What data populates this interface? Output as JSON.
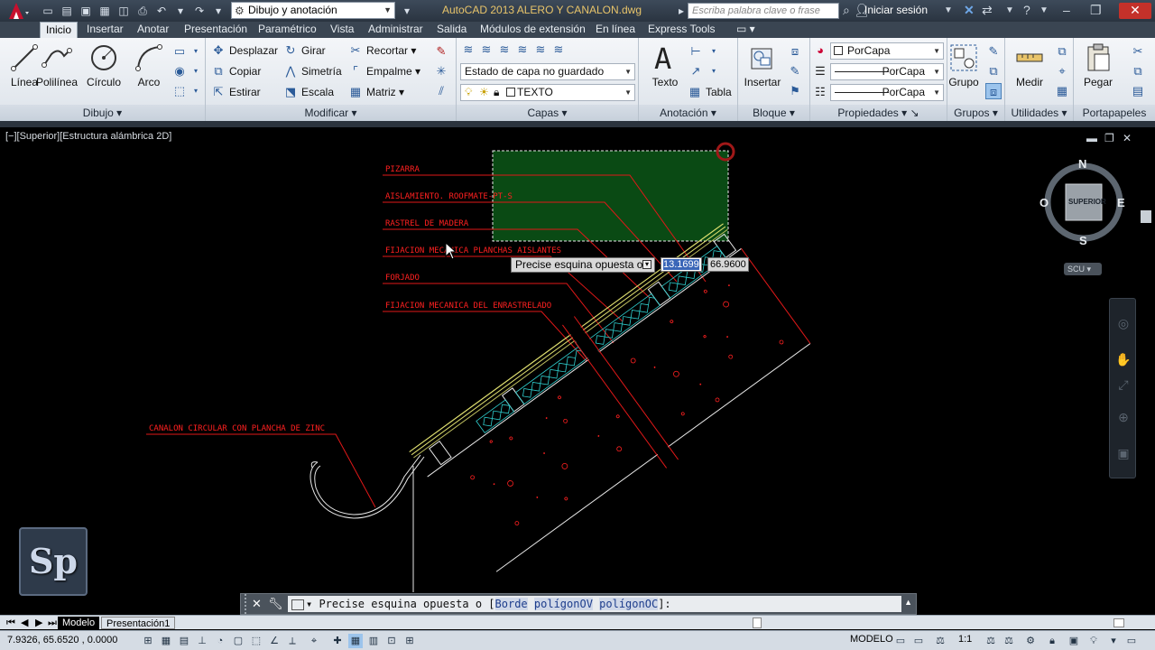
{
  "titlebar": {
    "workspace": "Dibujo y anotación",
    "document_title": "AutoCAD 2013   ALERO Y CANALON.dwg",
    "search_placeholder": "Escriba palabra clave o frase",
    "signin": "Iniciar sesión"
  },
  "ribbon_tabs": [
    "Inicio",
    "Insertar",
    "Anotar",
    "Presentación",
    "Paramétrico",
    "Vista",
    "Administrar",
    "Salida",
    "Módulos de extensión",
    "En línea",
    "Express Tools"
  ],
  "panels": {
    "dibujo": {
      "title": "Dibujo",
      "tools": [
        "Línea",
        "Polilínea",
        "Círculo",
        "Arco"
      ]
    },
    "modificar": {
      "title": "Modificar",
      "tools": [
        "Desplazar",
        "Girar",
        "Recortar",
        "Copiar",
        "Simetría",
        "Empalme",
        "Estirar",
        "Escala",
        "Matriz"
      ]
    },
    "capas": {
      "title": "Capas",
      "layer_state": "Estado de capa no guardado",
      "current_layer": "TEXTO"
    },
    "anotacion": {
      "title": "Anotación",
      "text": "Texto",
      "table": "Tabla"
    },
    "bloque": {
      "title": "Bloque",
      "insert": "Insertar"
    },
    "propiedades": {
      "title": "Propiedades",
      "color": "PorCapa",
      "linetype": "PorCapa",
      "lineweight": "PorCapa"
    },
    "grupos": {
      "title": "Grupos",
      "group": "Grupo"
    },
    "utilidades": {
      "title": "Utilidades",
      "measure": "Medir"
    },
    "portapapeles": {
      "title": "Portapapeles",
      "paste": "Pegar"
    }
  },
  "viewport": {
    "label": "[−][Superior][Estructura alámbrica 2D]"
  },
  "viewcube": {
    "north": "N",
    "south": "S",
    "east": "E",
    "west": "O",
    "face": "SUPERIOR",
    "ucs": "SCU"
  },
  "drawing_labels": {
    "pizarra": "PIZARRA",
    "aislamiento": "AISLAMIENTO. ROOFMATE-PT-S",
    "rastrel": "RASTREL DE MADERA",
    "fijacion_planchas": "FIJACION MECANICA PLANCHAS AISLANTES",
    "forjado": "FORJADO",
    "fijacion_enrastrelado": "FIJACION MECANICA DEL ENRASTRELADO",
    "canalon": "CANALON CIRCULAR CON PLANCHA DE ZINC"
  },
  "dynamic_input": {
    "prompt": "Precise esquina opuesta o",
    "value_x": "13.1699",
    "value_y": "66.9600"
  },
  "logo_text": "Sp",
  "command_line": {
    "prompt": "Precise esquina opuesta o [",
    "options": [
      "Borde",
      "polígonOV",
      "polígonOC"
    ],
    "end": "]:"
  },
  "layout_tabs": [
    "Modelo",
    "Presentación1"
  ],
  "statusbar": {
    "coords": "7.9326,  65.6520 , 0.0000",
    "model": "MODELO",
    "scale": "1:1"
  },
  "colors": {
    "annotation_red": "#ff2020",
    "leader_red": "#e01818",
    "selection_fill": "#0a4a14",
    "insulation_cyan": "#2fd0d0",
    "slate_yellow": "#e0e070"
  }
}
